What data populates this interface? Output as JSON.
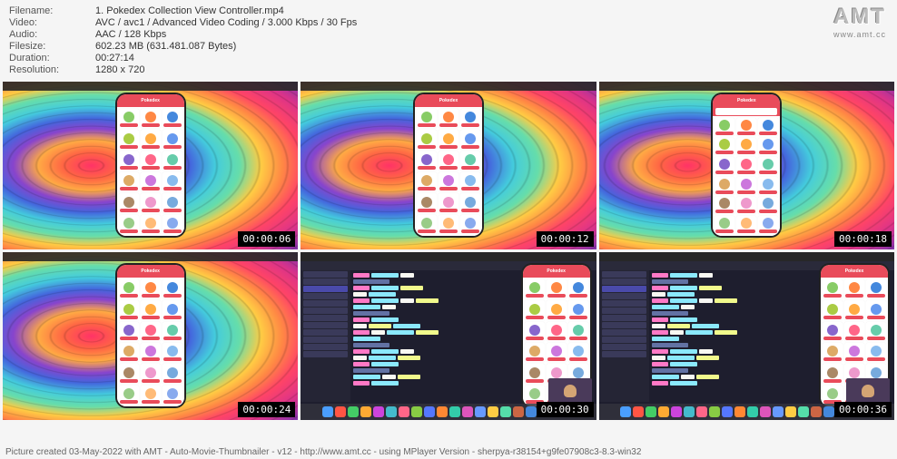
{
  "meta": {
    "filename_label": "Filename:",
    "filename": "1. Pokedex Collection View Controller.mp4",
    "video_label": "Video:",
    "video": "AVC / avc1 / Advanced Video Coding / 3.000 Kbps / 30 Fps",
    "audio_label": "Audio:",
    "audio": "AAC / 128 Kbps",
    "filesize_label": "Filesize:",
    "filesize": "602.23 MB (631.481.087 Bytes)",
    "duration_label": "Duration:",
    "duration": "00:27:14",
    "resolution_label": "Resolution:",
    "resolution": "1280 x 720"
  },
  "logo": {
    "brand": "AMT",
    "url": "www.amt.cc"
  },
  "thumbs": [
    {
      "ts": "00:00:06",
      "type": "sim"
    },
    {
      "ts": "00:00:12",
      "type": "sim"
    },
    {
      "ts": "00:00:18",
      "type": "sim-search"
    },
    {
      "ts": "00:00:24",
      "type": "sim"
    },
    {
      "ts": "00:00:30",
      "type": "xcode"
    },
    {
      "ts": "00:00:36",
      "type": "xcode"
    }
  ],
  "phone": {
    "title": "Pokedex"
  },
  "footer": "Picture created 03-May-2022 with AMT - Auto-Movie-Thumbnailer - v12 - http://www.amt.cc - using MPlayer Version - sherpya-r38154+g9fe07908c3-8.3-win32",
  "poke_colors": [
    "#88cc66",
    "#ff8844",
    "#4488dd",
    "#aacc44",
    "#ffaa44",
    "#6699ee",
    "#8866cc",
    "#ff6688",
    "#66ccaa",
    "#ddaa66",
    "#cc77dd",
    "#88bbee",
    "#aa8866",
    "#ee99cc",
    "#77aadd",
    "#99cc88",
    "#ffbb77",
    "#88aaee"
  ],
  "dock_colors": [
    "#4a9eff",
    "#ff5544",
    "#44cc66",
    "#ffaa33",
    "#cc44dd",
    "#44bbcc",
    "#ff6688",
    "#88cc44",
    "#5577ff",
    "#ff8833",
    "#33ccaa",
    "#dd55bb",
    "#6699ff",
    "#ffcc44",
    "#55ddaa",
    "#cc6644",
    "#4488dd",
    "#ff77aa",
    "#88bb55",
    "#aa66ff"
  ]
}
